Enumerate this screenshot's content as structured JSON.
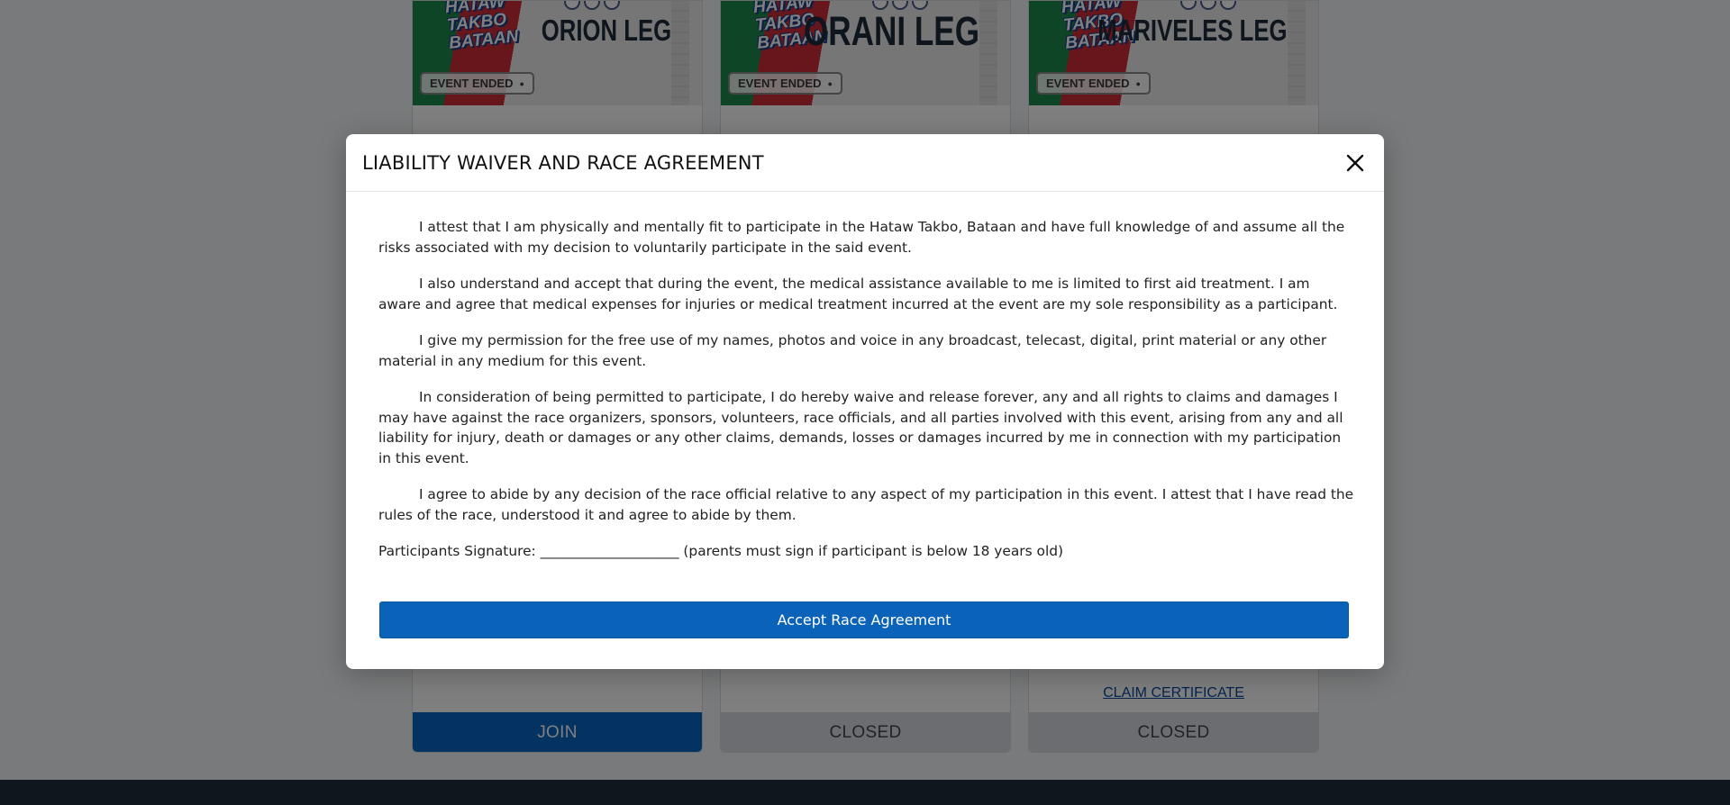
{
  "cards": [
    {
      "leg": "ORION LEG",
      "logo": [
        "HATAW",
        "TAKBO",
        "BATAAN"
      ],
      "badge": "EVENT ENDED",
      "button": "JOIN",
      "links": []
    },
    {
      "leg": "ORANI LEG",
      "logo": [
        "HATAW",
        "TAKBO",
        "BATAAN"
      ],
      "badge": "EVENT ENDED",
      "button": "CLOSED",
      "links": []
    },
    {
      "leg": "MARIVELES LEG",
      "logo": [
        "HATAW",
        "TAKBO",
        "BATAAN"
      ],
      "badge": "EVENT ENDED",
      "button": "CLOSED",
      "links": [
        "CLAIM CERTIFICATE"
      ]
    }
  ],
  "modal": {
    "title": "LIABILITY WAIVER AND RACE AGREEMENT",
    "paragraphs": [
      "I attest that I am physically and mentally fit to participate in the Hataw Takbo, Bataan and have full knowledge of and assume all the risks associated with my decision to voluntarily participate in the said event.",
      "I also understand and accept that during the event, the medical assistance available to me is limited to first aid treatment. I am aware and agree that medical expenses for injuries or medical treatment incurred at the event are my sole responsibility as a participant.",
      "I give my permission for the free use of my names, photos and voice in any broadcast, telecast, digital, print material or any other material in any medium for this event.",
      "In consideration of being permitted to participate, I do hereby waive and release forever, any and all rights to claims and damages I may have against the race organizers, sponsors, volunteers, race officials, and all parties involved with this event, arising from any and all liability for injury, death or damages or any other claims, demands, losses or damages incurred by me in connection with my participation in this event.",
      "I agree to abide by any decision of the race official relative to any aspect of my participation in this event. I attest that I have read the rules of the race, understood it and agree to abide by them."
    ],
    "signature": "Participants Signature: ____________________ (parents must sign if participant is below 18 years old)",
    "accept_button": "Accept Race Agreement"
  },
  "colors": {
    "primary": "#0a63b8",
    "overlay": "rgba(0,0,0,0.5)",
    "footer": "#1e2d3d"
  },
  "icons": {
    "close": "close-icon"
  }
}
